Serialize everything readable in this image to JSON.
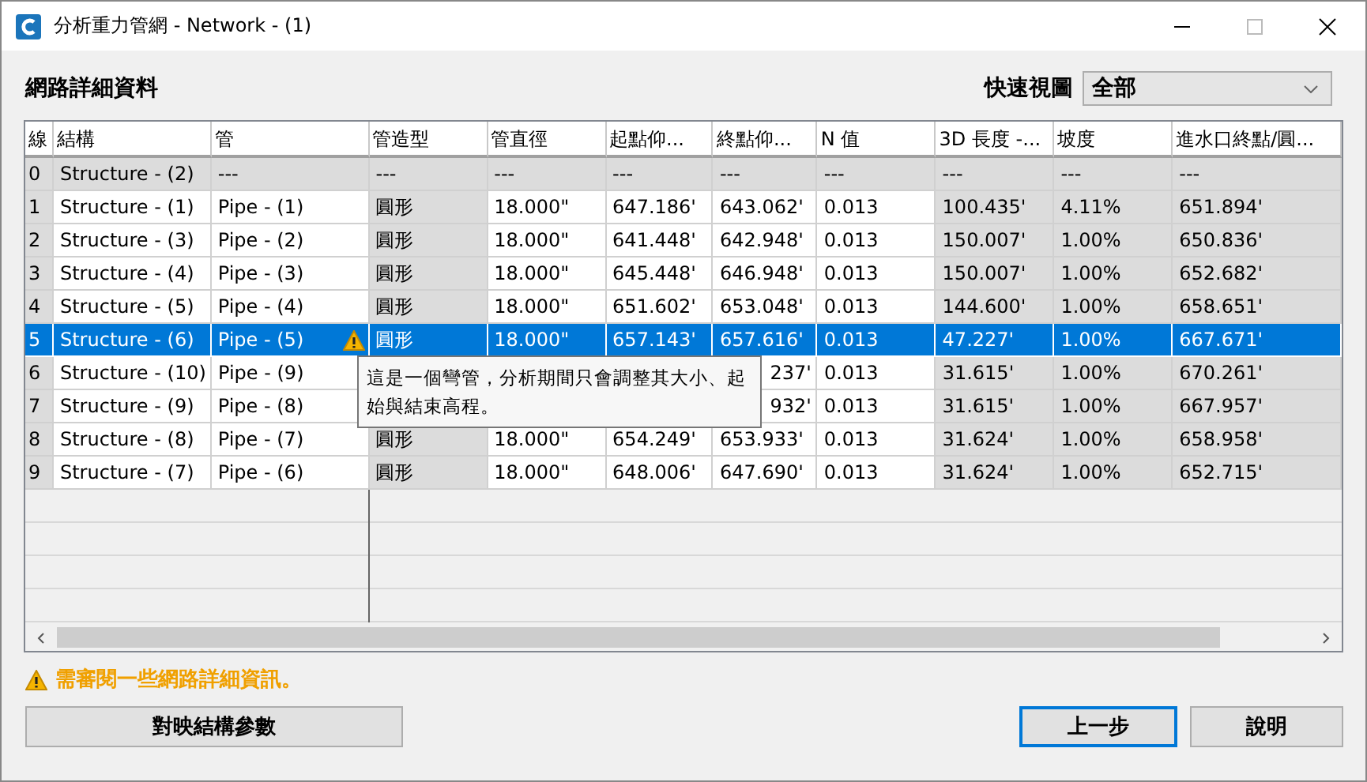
{
  "window": {
    "title": "分析重力管網 - Network - (1)"
  },
  "heading": "網路詳細資料",
  "quick_view": {
    "label": "快速視圖",
    "value": "全部"
  },
  "table": {
    "columns": [
      {
        "label": "線",
        "shaded": true
      },
      {
        "label": "結構",
        "shaded": false
      },
      {
        "label": "管",
        "shaded": false
      },
      {
        "label": "管造型",
        "shaded": true
      },
      {
        "label": "管直徑",
        "shaded": false
      },
      {
        "label": "起點仰...",
        "shaded": false
      },
      {
        "label": "終點仰...",
        "shaded": false
      },
      {
        "label": "N 值",
        "shaded": false
      },
      {
        "label": "3D 長度 -...",
        "shaded": true
      },
      {
        "label": "坡度",
        "shaded": true
      },
      {
        "label": "進水口終點/圓...",
        "shaded": true
      }
    ],
    "rows": [
      {
        "selected": false,
        "warning": false,
        "disabled": true,
        "cells": [
          "0",
          "Structure - (2)",
          "---",
          "---",
          "---",
          "---",
          "---",
          "---",
          "---",
          "---",
          "---"
        ]
      },
      {
        "selected": false,
        "warning": false,
        "disabled": false,
        "cells": [
          "1",
          "Structure - (1)",
          "Pipe - (1)",
          "圓形",
          "18.000\"",
          "647.186'",
          "643.062'",
          "0.013",
          "100.435'",
          "4.11%",
          "651.894'"
        ]
      },
      {
        "selected": false,
        "warning": false,
        "disabled": false,
        "cells": [
          "2",
          "Structure - (3)",
          "Pipe - (2)",
          "圓形",
          "18.000\"",
          "641.448'",
          "642.948'",
          "0.013",
          "150.007'",
          "1.00%",
          "650.836'"
        ]
      },
      {
        "selected": false,
        "warning": false,
        "disabled": false,
        "cells": [
          "3",
          "Structure - (4)",
          "Pipe - (3)",
          "圓形",
          "18.000\"",
          "645.448'",
          "646.948'",
          "0.013",
          "150.007'",
          "1.00%",
          "652.682'"
        ]
      },
      {
        "selected": false,
        "warning": false,
        "disabled": false,
        "cells": [
          "4",
          "Structure - (5)",
          "Pipe - (4)",
          "圓形",
          "18.000\"",
          "651.602'",
          "653.048'",
          "0.013",
          "144.600'",
          "1.00%",
          "658.651'"
        ]
      },
      {
        "selected": true,
        "warning": true,
        "disabled": false,
        "cells": [
          "5",
          "Structure - (6)",
          "Pipe - (5)",
          "圓形",
          "18.000\"",
          "657.143'",
          "657.616'",
          "0.013",
          "47.227'",
          "1.00%",
          "667.671'"
        ]
      },
      {
        "selected": false,
        "warning": false,
        "disabled": false,
        "cells": [
          "6",
          "Structure - (10)",
          "Pipe - (9)",
          null,
          null,
          null,
          "237'",
          "0.013",
          "31.615'",
          "1.00%",
          "670.261'"
        ]
      },
      {
        "selected": false,
        "warning": false,
        "disabled": false,
        "cells": [
          "7",
          "Structure - (9)",
          "Pipe - (8)",
          null,
          null,
          null,
          "932'",
          "0.013",
          "31.615'",
          "1.00%",
          "667.957'"
        ]
      },
      {
        "selected": false,
        "warning": false,
        "disabled": false,
        "cells": [
          "8",
          "Structure - (8)",
          "Pipe - (7)",
          "圓形",
          "18.000\"",
          "654.249'",
          "653.933'",
          "0.013",
          "31.624'",
          "1.00%",
          "658.958'"
        ]
      },
      {
        "selected": false,
        "warning": false,
        "disabled": false,
        "cells": [
          "9",
          "Structure - (7)",
          "Pipe - (6)",
          "圓形",
          "18.000\"",
          "648.006'",
          "647.690'",
          "0.013",
          "31.624'",
          "1.00%",
          "652.715'"
        ]
      }
    ]
  },
  "tooltip": "這是一個彎管，分析期間只會調整其大小、起始與結束高程。",
  "status_message": "需審閱一些網路詳細資訊。",
  "buttons": [
    {
      "label": "對映結構參數",
      "default": false
    },
    {
      "label": "上一步",
      "default": true
    },
    {
      "label": "說明",
      "default": false
    }
  ]
}
